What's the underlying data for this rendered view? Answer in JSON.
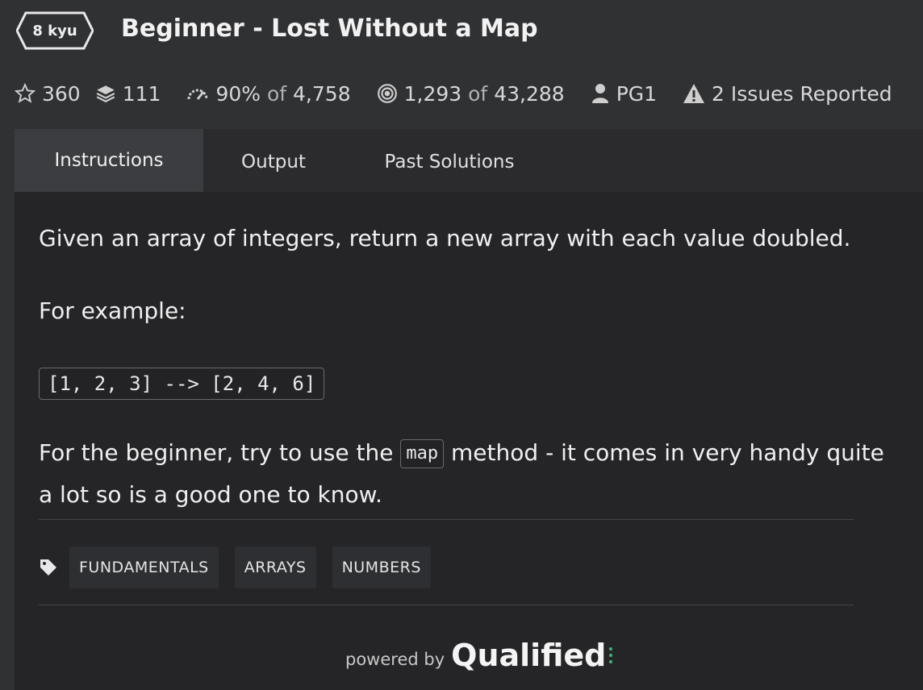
{
  "header": {
    "kyu": "8 kyu",
    "title": "Beginner - Lost Without a Map"
  },
  "stats": {
    "stars": "360",
    "collections": "111",
    "satisfaction_pct": "90%",
    "satisfaction_of": "of",
    "satisfaction_total": "4,758",
    "completed": "1,293",
    "completed_of": "of",
    "completed_total": "43,288",
    "author": "PG1",
    "issues": "2 Issues Reported"
  },
  "tabs": [
    {
      "label": "Instructions",
      "active": true
    },
    {
      "label": "Output",
      "active": false
    },
    {
      "label": "Past Solutions",
      "active": false
    }
  ],
  "content": {
    "intro": "Given an array of integers, return a new array with each value doubled.",
    "example_label": "For example:",
    "example_code": "[1, 2, 3] --> [2, 4, 6]",
    "tip_before": "For the beginner, try to use the",
    "tip_code": "map",
    "tip_after": "method - it comes in very handy quite a lot so is a good one to know."
  },
  "tags": [
    "FUNDAMENTALS",
    "ARRAYS",
    "NUMBERS"
  ],
  "footer": {
    "powered_by": "powered by",
    "brand": "Qualified"
  },
  "colors": {
    "background": "#303133",
    "panel": "#252528",
    "active_tab": "#3c3d40",
    "accent_green": "#3fb37f"
  }
}
